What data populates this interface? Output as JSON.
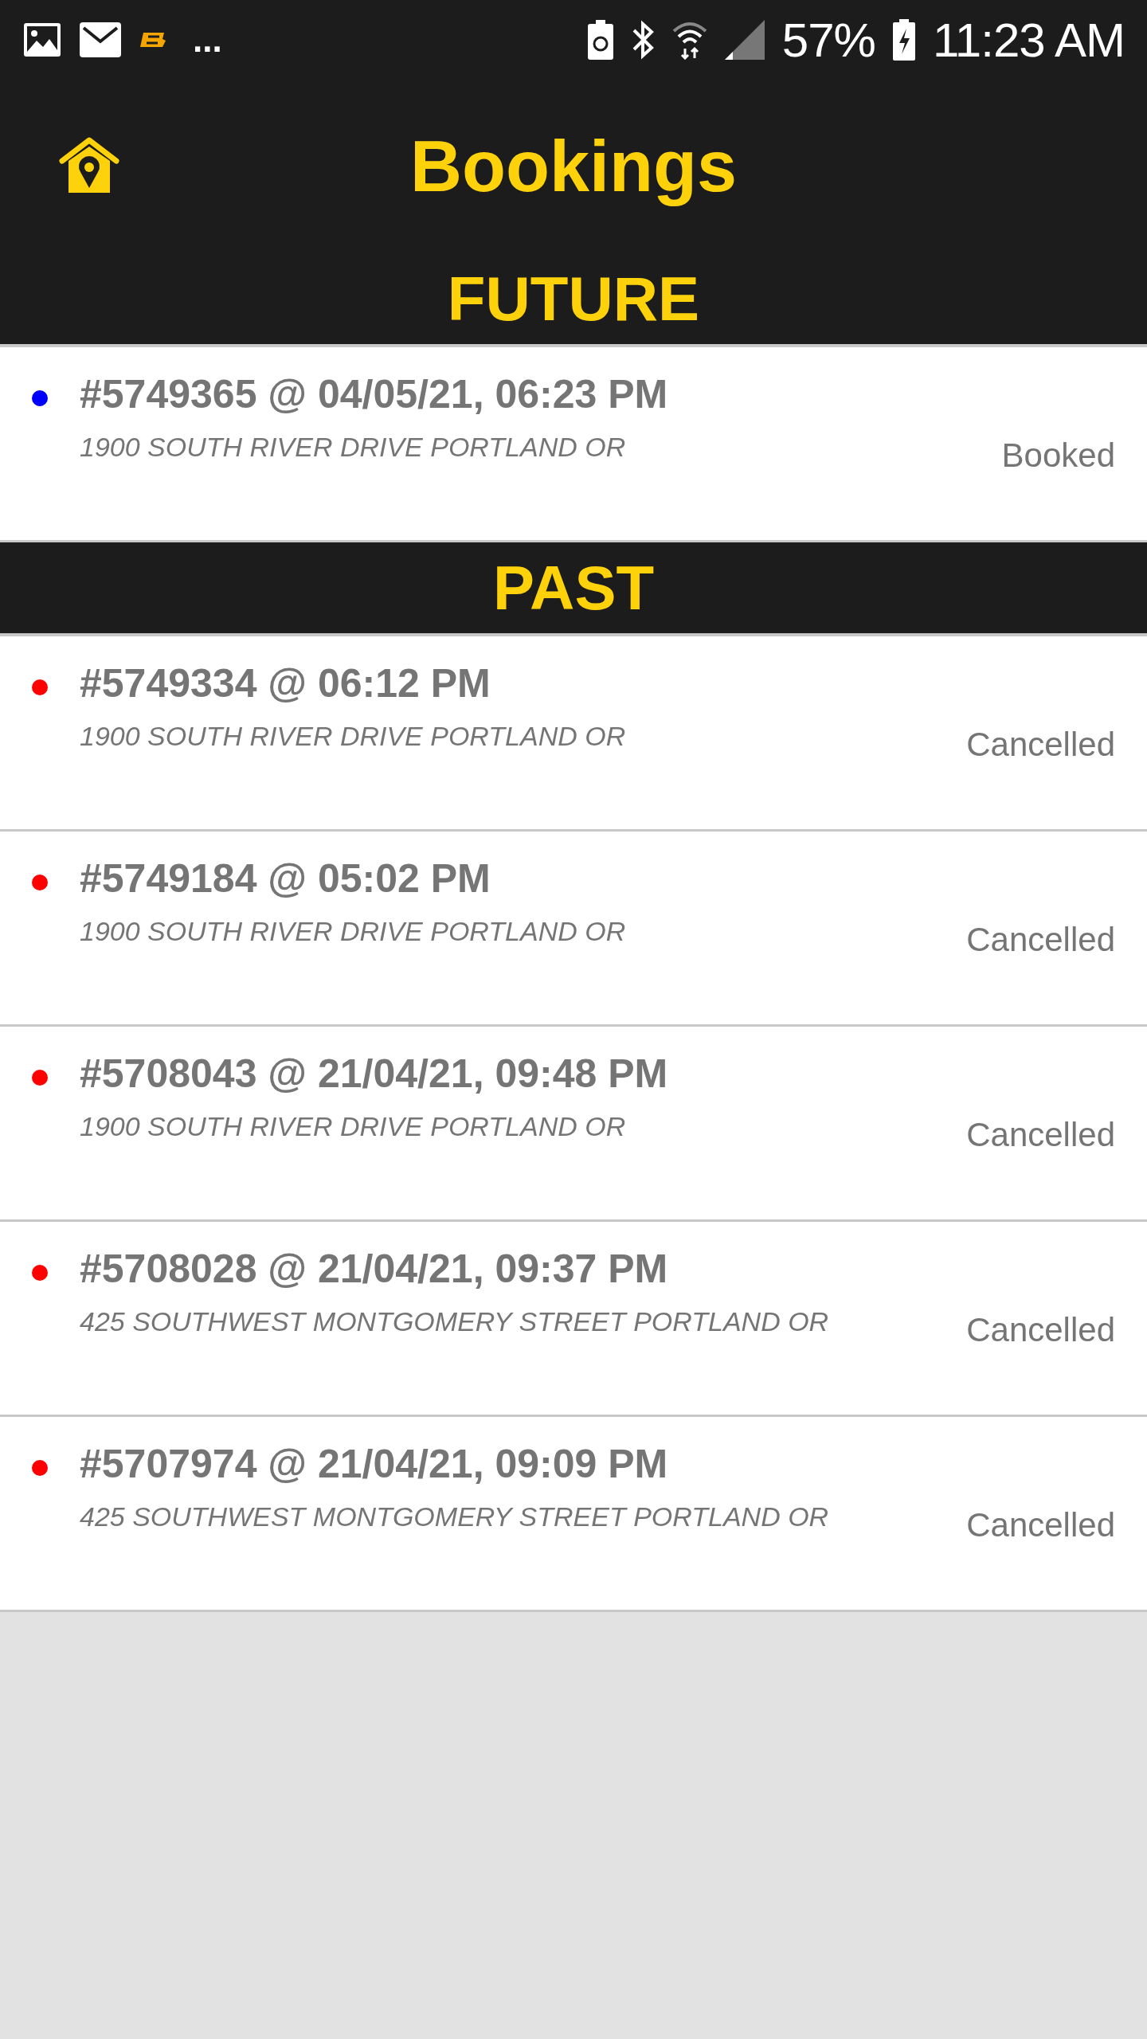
{
  "status_bar": {
    "overflow": "...",
    "battery": "57%",
    "time": "11:23 AM"
  },
  "header": {
    "title": "Bookings"
  },
  "sections": [
    {
      "title": "FUTURE",
      "bookings": [
        {
          "title": "#5749365 @ 04/05/21, 06:23 PM",
          "address": "1900 SOUTH RIVER DRIVE PORTLAND OR",
          "status": "Booked",
          "color": "#0000ff"
        }
      ]
    },
    {
      "title": "PAST",
      "bookings": [
        {
          "title": "#5749334 @ 06:12 PM",
          "address": "1900 SOUTH RIVER DRIVE PORTLAND OR",
          "status": "Cancelled",
          "color": "#ff0000"
        },
        {
          "title": "#5749184 @ 05:02 PM",
          "address": "1900 SOUTH RIVER DRIVE PORTLAND OR",
          "status": "Cancelled",
          "color": "#ff0000"
        },
        {
          "title": "#5708043 @ 21/04/21, 09:48 PM",
          "address": "1900 SOUTH RIVER DRIVE PORTLAND OR",
          "status": "Cancelled",
          "color": "#ff0000"
        },
        {
          "title": "#5708028 @ 21/04/21, 09:37 PM",
          "address": "425 SOUTHWEST MONTGOMERY STREET PORTLAND OR",
          "status": "Cancelled",
          "color": "#ff0000"
        },
        {
          "title": "#5707974 @ 21/04/21, 09:09 PM",
          "address": "425 SOUTHWEST MONTGOMERY STREET PORTLAND OR",
          "status": "Cancelled",
          "color": "#ff0000"
        }
      ]
    }
  ]
}
